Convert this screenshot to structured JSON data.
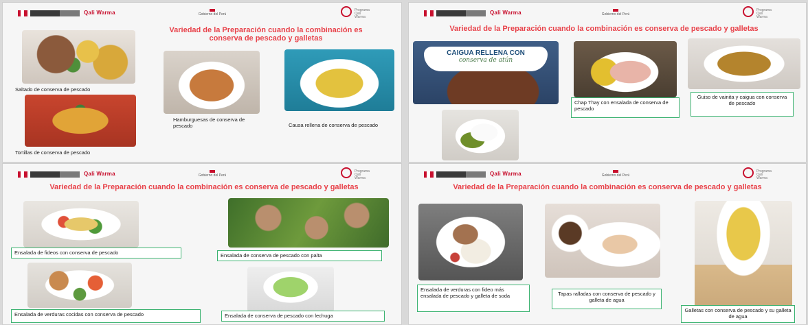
{
  "header": {
    "brand": "Qali Warma",
    "center_text": "Gobierno del Perú",
    "seal_text": "Programa Qali Warma"
  },
  "slides": [
    {
      "title": "Variedad de la Preparación cuando la combinación es conserva de pescado y galletas",
      "captions": [
        "Saltado de conserva de pescado",
        "Tortillas  de conserva de pescado",
        "Hamburguesas de conserva de pescado",
        "Causa rellena de conserva de pescado"
      ]
    },
    {
      "title": "Variedad de la Preparación cuando la combinación es conserva de pescado y galletas",
      "banner_line1": "CAIGUA RELLENA CON",
      "banner_line2": "conserva de atún",
      "captions": [
        "Chap Thay con ensalada de conserva de pescado",
        "Guiso de vainita y caigua con conserva de pescado"
      ]
    },
    {
      "title": "Variedad de la Preparación cuando la combinación es conserva de pescado y galletas",
      "captions": [
        "Ensalada de fideos con conserva de pescado",
        "Ensalada de conserva de pescado con palta",
        "Ensalada de verduras cocidas con conserva de pescado",
        "Ensalada de conserva de pescado con lechuga"
      ]
    },
    {
      "title": "Variedad de la Preparación cuando la combinación es conserva de pescado y galletas",
      "captions": [
        "Ensalada de verduras con fideo más ensalada de pescado y galleta de soda",
        "Tapas ralladas con conserva de pescado y galleta de agua",
        "Galletas con conserva de pescado y su galleta de agua"
      ]
    }
  ],
  "colors": {
    "title_red": "#e8424a",
    "caption_border": "#3cb371",
    "brand_red": "#c8102e"
  }
}
